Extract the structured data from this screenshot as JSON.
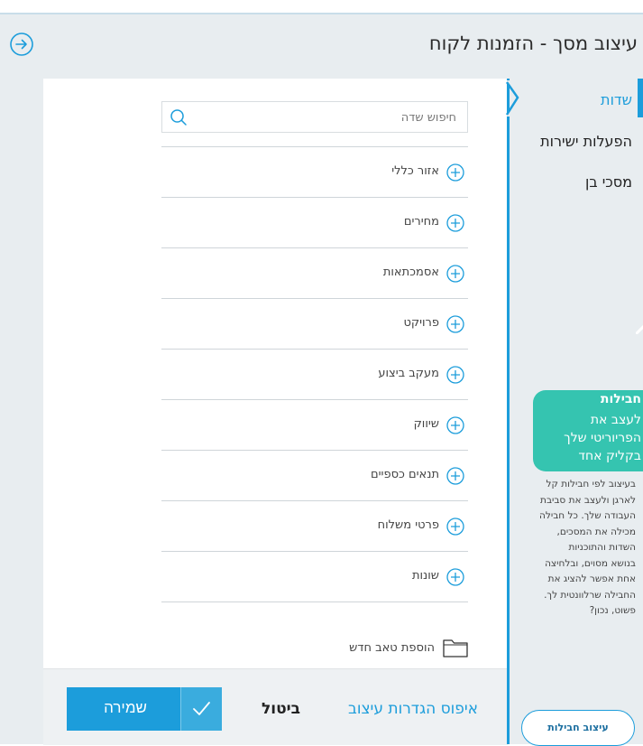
{
  "header": {
    "title": "עיצוב מסך - הזמנות לקוח",
    "back_icon": "arrow-right-circle-icon"
  },
  "search": {
    "placeholder": "חיפוש שדה"
  },
  "fields": [
    {
      "label": "אזור כללי"
    },
    {
      "label": "מחירים"
    },
    {
      "label": "אסמכתאות"
    },
    {
      "label": "פרויקט"
    },
    {
      "label": "מעקב ביצוע"
    },
    {
      "label": "שיווק"
    },
    {
      "label": "תנאים כספיים"
    },
    {
      "label": "פרטי משלוח"
    },
    {
      "label": "שונות"
    }
  ],
  "add_tab_label": "הוספת טאב חדש",
  "footer": {
    "save_label": "שמירה",
    "cancel_label": "ביטול",
    "reset_label": "איפוס הגדרות עיצוב"
  },
  "tabs": {
    "fields": "שדות",
    "direct_actions": "הפעלות ישירות",
    "sub_screens": "מסכי בן"
  },
  "promo": {
    "title": "חבילות",
    "subtitle_lines": [
      "לעצב את",
      "הפריוריטי שלך",
      "בקליק אחד"
    ],
    "description_lines": [
      "בעיצוב לפי חבילות קל",
      "לארגן ולעצב את סביבת",
      "העבודה שלך. כל חבילה",
      "מכילה את המסכים,",
      "השדות והתוכניות",
      "בנושא מסוים, ובלחיצה",
      "אחת אפשר להציג את",
      "החבילה שרלוונטית לך.",
      "פשוט, נכון?"
    ],
    "button_label": "עיצוב חבילות"
  },
  "colors": {
    "accent": "#1c9ddb",
    "promo": "#35c4b0",
    "background": "#e8edf0"
  }
}
